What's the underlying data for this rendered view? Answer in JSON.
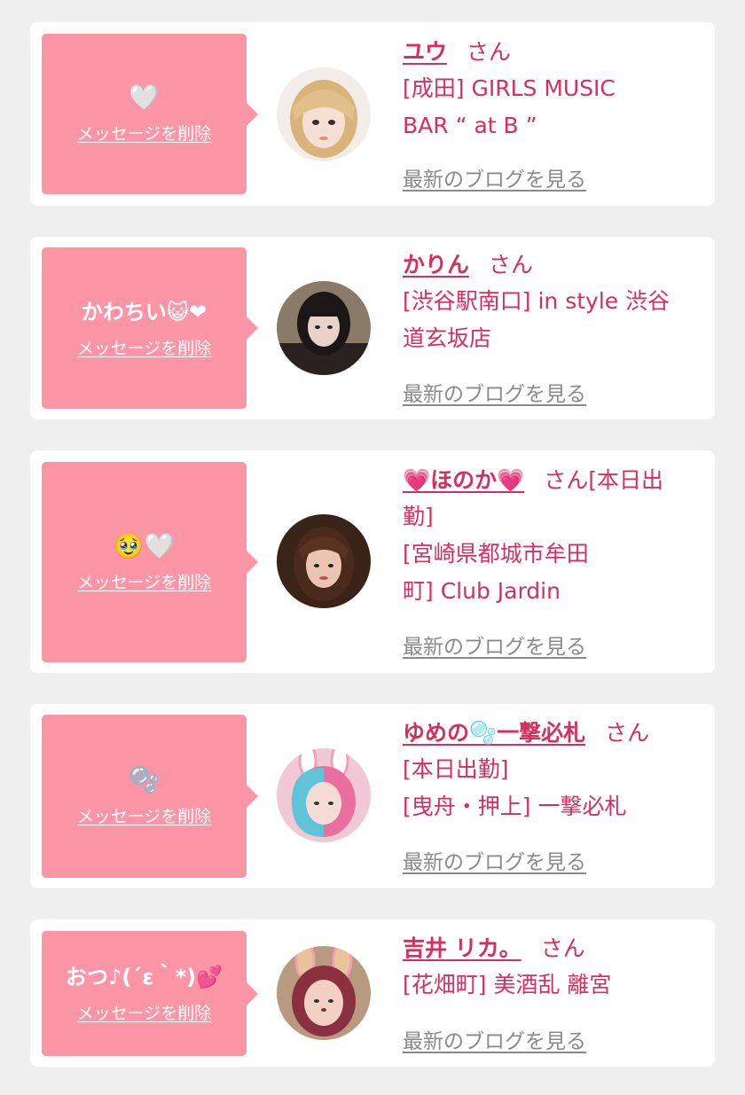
{
  "cards": [
    {
      "message": "🤍",
      "delete_label": "メッセージを削除",
      "name": "ユウ",
      "honorific": "さん",
      "shop_lines": [
        "[成田] GIRLS MUSIC",
        "BAR “ at B ”"
      ],
      "blog_label": "最新のブログを見る",
      "avatar": "blonde-girl-avatar"
    },
    {
      "message": "かわちい😺❤",
      "delete_label": "メッセージを削除",
      "name": "かりん",
      "honorific": "さん",
      "shop_lines": [
        "[渋谷駅南口] in style 渋谷",
        "道玄坂店"
      ],
      "blog_label": "最新のブログを見る",
      "avatar": "dark-hair-girl-avatar"
    },
    {
      "message": "🥹🤍",
      "delete_label": "メッセージを削除",
      "name": "💗ほのか💗",
      "honorific": "さん[本日出",
      "shop_lines": [
        "勤]",
        "[宮崎県都城市牟田",
        "町] Club Jardin"
      ],
      "blog_label": "最新のブログを見る",
      "avatar": "brown-hair-girl-avatar"
    },
    {
      "message": "🫧",
      "delete_label": "メッセージを削除",
      "name": "ゆめの🫧一撃必札",
      "honorific": "さん",
      "shop_lines": [
        "[本日出勤]",
        "[曳舟・押上] 一撃必札"
      ],
      "blog_label": "最新のブログを見る",
      "avatar": "bunny-ears-colorful-hair-avatar"
    },
    {
      "message": "おつ♪(´ε｀*)💕",
      "delete_label": "メッセージを削除",
      "name": "吉井 リカ。",
      "honorific": "さん",
      "shop_lines": [
        "[花畑町] 美酒乱 離宮"
      ],
      "blog_label": "最新のブログを見る",
      "avatar": "bunny-filter-avatar"
    }
  ],
  "colors": {
    "background": "#efefef",
    "card": "#ffffff",
    "bubble": "#fc95a5",
    "accent": "#d72f5d",
    "blog_link": "#8a8a8a"
  }
}
